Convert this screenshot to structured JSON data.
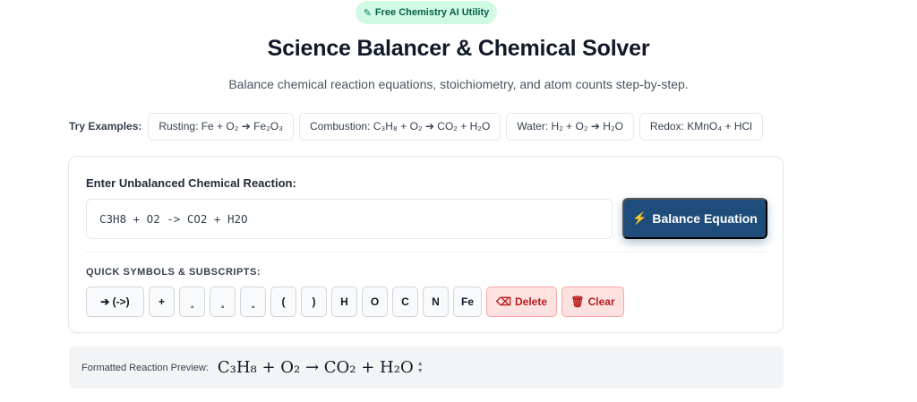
{
  "badge": {
    "icon": "pencil-icon",
    "label": "Free Chemistry AI Utility"
  },
  "header": {
    "title": "Science Balancer & Chemical Solver",
    "subtitle": "Balance chemical reaction equations, stoichiometry, and atom counts step-by-step."
  },
  "examples": {
    "label": "Try Examples:",
    "items": [
      "Rusting: Fe + O₂ ➔ Fe₂O₃",
      "Combustion: C₃H₈ + O₂ ➔ CO₂ + H₂O",
      "Water: H₂ + O₂ ➔ H₂O",
      "Redox: KMnO₄ + HCl"
    ]
  },
  "input_card": {
    "label": "Enter Unbalanced Chemical Reaction:",
    "value": "C3H8 + O2 -> CO2 + H2O",
    "balance_button": {
      "icon": "lightning-icon",
      "label": "Balance Equation"
    },
    "quick_symbols_label": "QUICK SYMBOLS & SUBSCRIPTS:",
    "keys": [
      "➔ (->)",
      "+",
      "₂",
      "₃",
      "₄",
      "(",
      ")",
      "H",
      "O",
      "C",
      "N",
      "Fe"
    ],
    "delete_button": {
      "icon": "backspace-icon",
      "label": "Delete"
    },
    "clear_button": {
      "icon": "trash-icon",
      "label": "Clear"
    }
  },
  "preview": {
    "label": "Formatted Reaction Preview:",
    "formula": "C₃H₈ + O₂ → CO₂ + H₂O"
  },
  "colors": {
    "badge_bg": "#d1fae5",
    "primary_button": "#1e4d7b",
    "danger_bg": "#fee2e2",
    "danger_text": "#b91c1c"
  }
}
